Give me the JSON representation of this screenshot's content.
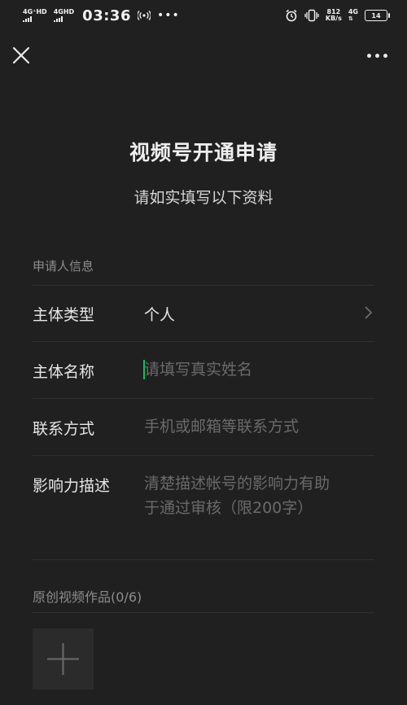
{
  "status_bar": {
    "net1": "4G⁺HD",
    "net2": "4GHD",
    "time": "03:36",
    "speed_value": "812",
    "speed_unit": "KB/s",
    "net3": "4G",
    "battery": "14"
  },
  "page": {
    "title": "视频号开通申请",
    "subtitle": "请如实填写以下资料"
  },
  "applicant_section": {
    "label": "申请人信息",
    "rows": [
      {
        "label": "主体类型",
        "value": "个人"
      },
      {
        "label": "主体名称",
        "placeholder": "请填写真实姓名"
      },
      {
        "label": "联系方式",
        "placeholder": "手机或邮箱等联系方式"
      },
      {
        "label": "影响力描述",
        "placeholder_line1": "清楚描述帐号的影响力有助",
        "placeholder_line2": "于通过审核（限200字）"
      }
    ]
  },
  "works_section": {
    "label": "原创视频作品(0/6)"
  },
  "icons": {
    "close": "close-icon",
    "more": "more-icon",
    "chevron": "chevron-right-icon",
    "add": "plus-icon"
  },
  "colors": {
    "background": "#202020",
    "accent": "#07c160"
  }
}
